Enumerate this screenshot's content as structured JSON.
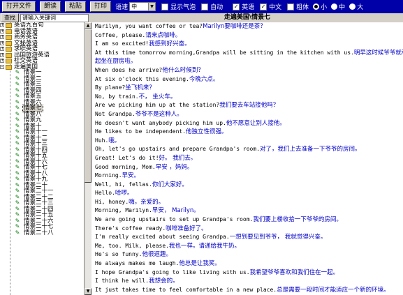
{
  "toolbar": {
    "open_file": "打开文件",
    "read": "朗读",
    "paste": "粘贴",
    "print": "打印",
    "speed_label": "语速",
    "speed_value": "中",
    "show_bubble": "显示气泡",
    "auto": "自动",
    "english": "英语",
    "chinese": "中文",
    "bold": "粗体",
    "size_small": "小",
    "size_medium": "中",
    "size_large": "大"
  },
  "search": {
    "button": "查找",
    "placeholder": "请输入关键词"
  },
  "content_title": "走遍美国\\情景七",
  "tree": {
    "categories": [
      {
        "label": "英语九百句",
        "expander": "+"
      },
      {
        "label": "电话英语",
        "expander": "+"
      },
      {
        "label": "商务英语",
        "expander": "+"
      },
      {
        "label": "文秘英语",
        "expander": "+"
      },
      {
        "label": "求职英语",
        "expander": "+"
      },
      {
        "label": "出国旅游英语",
        "expander": "+"
      },
      {
        "label": "社交英语",
        "expander": "+"
      },
      {
        "label": "走遍美国",
        "expander": "-"
      }
    ],
    "scenes": [
      {
        "label": "情景一"
      },
      {
        "label": "情景二"
      },
      {
        "label": "情景三"
      },
      {
        "label": "情景四"
      },
      {
        "label": "情景五"
      },
      {
        "label": "情景六"
      },
      {
        "label": "情景七"
      },
      {
        "label": "情景八"
      },
      {
        "label": "情景九"
      },
      {
        "label": "情景十"
      },
      {
        "label": "情景十一"
      },
      {
        "label": "情景十二"
      },
      {
        "label": "情景十三"
      },
      {
        "label": "情景十四"
      },
      {
        "label": "情景十五"
      },
      {
        "label": "情景十六"
      },
      {
        "label": "情景十七"
      },
      {
        "label": "情景十八"
      },
      {
        "label": "情景十九"
      },
      {
        "label": "情景二十"
      },
      {
        "label": "情景二十一"
      },
      {
        "label": "情景二十二"
      },
      {
        "label": "情景二十三"
      },
      {
        "label": "情景二十四"
      },
      {
        "label": "情景二十五"
      },
      {
        "label": "情景二十六"
      },
      {
        "label": "情景二十七"
      },
      {
        "label": "情景二十八"
      }
    ],
    "selected_scene": "情景七"
  },
  "lines": [
    {
      "en": "Marilyn, you want coffee or tea?",
      "zh": "Marilyn要咖啡还是茶？"
    },
    {
      "en": "Coffee, please.",
      "zh": "请来点咖啡。"
    },
    {
      "en": "I am so excited!",
      "zh": "我感到好兴奋。"
    },
    {
      "en": "At this time tomorrow morning,Grandpa will be sitting in the kitchen with us.",
      "zh": "明早这时候爷爷就和我们一"
    },
    {
      "en": "",
      "zh": "起坐在厨房啦。"
    },
    {
      "en": "When does he arrive?",
      "zh": "他什么时候到？"
    },
    {
      "en": "At six o'clock this evening.",
      "zh": "今晚六点。"
    },
    {
      "en": "By plane?",
      "zh": "坐飞机来？"
    },
    {
      "en": "No, by train.",
      "zh": "不，  坐火车。"
    },
    {
      "en": "Are we picking him up at the station?",
      "zh": "我们要去车站接他吗？"
    },
    {
      "en": "Not Grandpa.",
      "zh": "爷爷不是这种人。"
    },
    {
      "en": "He doesn't want anybody picking him up.",
      "zh": "他不愿意让别人接他。"
    },
    {
      "en": "He likes to be independent.",
      "zh": "他独立性很强。"
    },
    {
      "en": "Huh.",
      "zh": "哦。"
    },
    {
      "en": "Oh, let's go upstairs and prepare Grandpa's room.",
      "zh": "对了，我们上去准备一下爷爷的房间。"
    },
    {
      "en": "Great! Let's do it!",
      "zh": "好。  我们去。"
    },
    {
      "en": "Good morning, Mom.",
      "zh": "早安  ，妈妈。"
    },
    {
      "en": "Morning.",
      "zh": "早安。"
    },
    {
      "en": "Well, hi, fellas.",
      "zh": "你们大家好。"
    },
    {
      "en": "Hello.",
      "zh": "哈啰。"
    },
    {
      "en": "Hi, honey.",
      "zh": "嗨，亲爱的。"
    },
    {
      "en": "Morning, Marilyn.",
      "zh": "早安，  Marilyn。"
    },
    {
      "en": "We are going upstairs to set up Grandpa's room.",
      "zh": "我们要上楼收拾一下爷爷的房间。"
    },
    {
      "en": "There's coffee ready.",
      "zh": "咖啡准备好了。"
    },
    {
      "en": "I'm really excited about seeing Grandpa.",
      "zh": "一想到要见到爷爷，  我就觉得兴奋。"
    },
    {
      "en": "Me, too. Milk, please.",
      "zh": "我也一样。请递给我牛奶。"
    },
    {
      "en": "He's so funny.",
      "zh": "他很逗趣。"
    },
    {
      "en": "He always makes me laugh.",
      "zh": "他总是让我笑。"
    },
    {
      "en": "I hope Grandpa's going to like living with us.",
      "zh": "我希望爷爷喜欢和我们住在一起。"
    },
    {
      "en": "I think he will.",
      "zh": "我想会的。"
    },
    {
      "en": "It just takes time to feel comfortable in a new place.",
      "zh": "总是需要一段时间才能适应一个新的环境。"
    }
  ],
  "selected_line": 18
}
